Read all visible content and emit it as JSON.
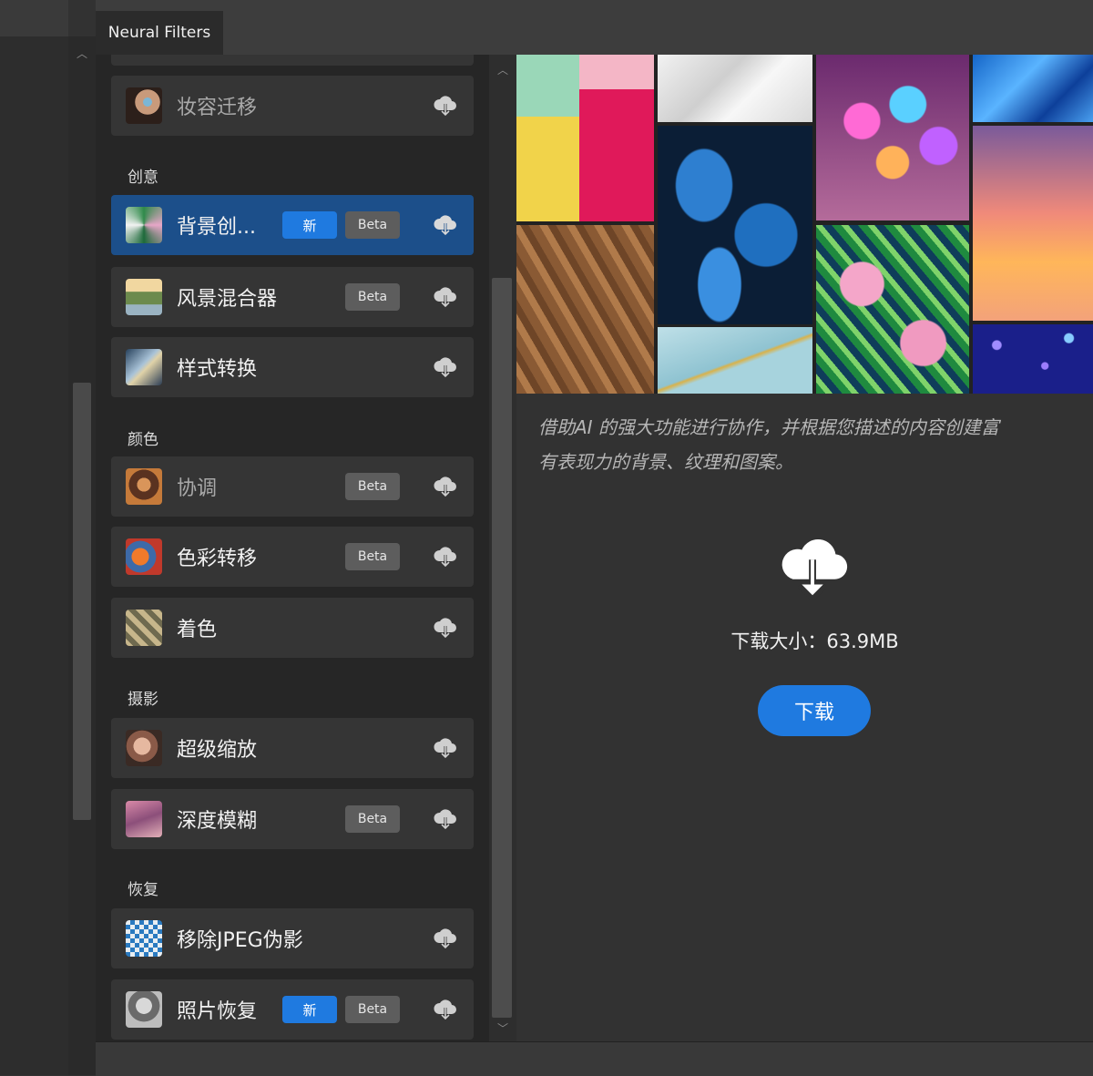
{
  "panel_tab": "Neural Filters",
  "sections": {
    "creative": "创意",
    "color": "颜色",
    "photography": "摄影",
    "restoration": "恢复"
  },
  "filters": {
    "makeup": {
      "label": "妆容迁移"
    },
    "bgcreator": {
      "label": "背景创...",
      "new": "新",
      "beta": "Beta"
    },
    "landscape": {
      "label": "风景混合器",
      "beta": "Beta"
    },
    "style": {
      "label": "样式转换"
    },
    "harmonize": {
      "label": "协调",
      "beta": "Beta"
    },
    "colortransfer": {
      "label": "色彩转移",
      "beta": "Beta"
    },
    "colorize": {
      "label": "着色"
    },
    "superzoom": {
      "label": "超级缩放"
    },
    "depthblur": {
      "label": "深度模糊",
      "beta": "Beta"
    },
    "jpeg": {
      "label": "移除JPEG伪影"
    },
    "photorestore": {
      "label": "照片恢复",
      "new": "新",
      "beta": "Beta"
    }
  },
  "detail": {
    "description_line1": "借助AI 的强大功能进行协作，并根据您描述的内容创建富",
    "description_line2": "有表现力的背景、纹理和图案。",
    "download_size": "下载大小：63.9MB",
    "download_button": "下载"
  },
  "colors": {
    "accent": "#1f7ae0",
    "selected_row": "#1c4f8a",
    "row_bg": "#353535",
    "beta_badge": "#5d5d5d"
  }
}
